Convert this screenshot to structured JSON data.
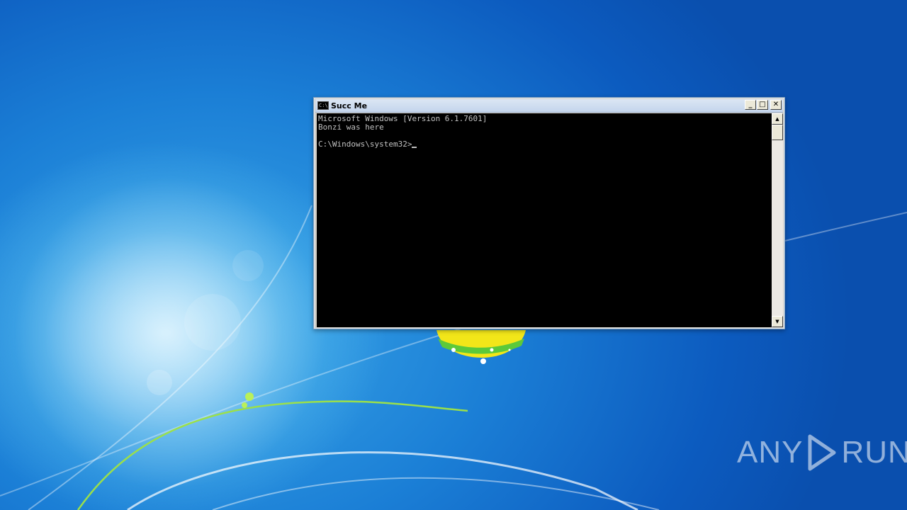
{
  "window": {
    "title": "Succ Me",
    "icon": "console-icon",
    "icon_glyph": "C:\\",
    "buttons": {
      "minimize": "_",
      "maximize": "□",
      "close": "✕"
    }
  },
  "console": {
    "lines": [
      "Microsoft Windows [Version 6.1.7601]",
      "Bonzi was here",
      "",
      "C:\\Windows\\system32>"
    ]
  },
  "scrollbar": {
    "up_glyph": "▲",
    "down_glyph": "▼"
  },
  "watermark": {
    "left_text": "ANY",
    "right_text": "RUN"
  },
  "colors": {
    "console_bg": "#000000",
    "console_fg": "#c0c0c0",
    "desktop_blue": "#1b7fd6"
  }
}
